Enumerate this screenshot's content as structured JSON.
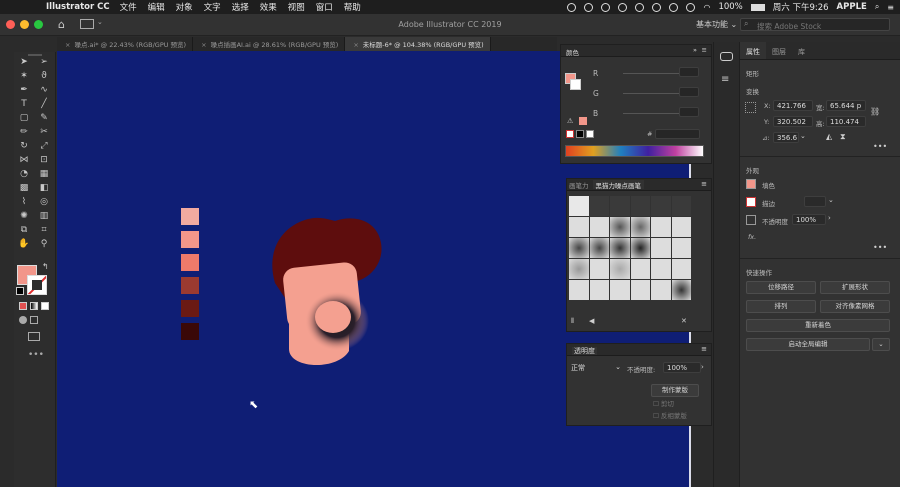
{
  "menubar": {
    "app_name": "Illustrator CC",
    "items": [
      "文件",
      "编辑",
      "对象",
      "文字",
      "选择",
      "效果",
      "视图",
      "窗口",
      "帮助"
    ],
    "battery": "100%",
    "clock": "周六 下午9:26",
    "user": "APPLE"
  },
  "appbar": {
    "title": "Adobe Illustrator CC 2019",
    "workspace": "基本功能",
    "search_placeholder": "搜索 Adobe Stock"
  },
  "tabs": [
    {
      "label": "噪点.ai* @ 22.43% (RGB/GPU 预览)"
    },
    {
      "label": "噪点插画AI.ai @ 28.61% (RGB/GPU 预览)"
    },
    {
      "label": "未标题-6* @ 104.38% (RGB/GPU 预览)"
    }
  ],
  "color_panel": {
    "title": "颜色",
    "channels": [
      "R",
      "G",
      "B"
    ],
    "hex_symbol": "#"
  },
  "brush_panel": {
    "tabs": [
      "画笔力",
      "黑猫力噪点画笔"
    ]
  },
  "transparency_panel": {
    "title": "透明度",
    "mode": "正常",
    "opacity_label": "不透明度:",
    "opacity_value": "100%",
    "make_mask": "制作蒙版",
    "clip": "剪切",
    "invert": "反相蒙版"
  },
  "properties_panel": {
    "tabs": [
      "属性",
      "图层",
      "库"
    ],
    "shape_label": "矩形",
    "transform_label": "变换",
    "x_label": "X:",
    "x_value": "421.766",
    "y_label": "Y:",
    "y_value": "320.502",
    "w_label": "宽:",
    "w_value": "65.644 p",
    "h_label": "高:",
    "h_value": "110.474",
    "angle_label": "⊿:",
    "angle_value": "356.6",
    "appearance_label": "外观",
    "fill_label": "填色",
    "stroke_label": "描边",
    "opacity_label": "不透明度",
    "opacity_value": "100%",
    "fx_label": "fx.",
    "quick_actions_label": "快速操作",
    "buttons": [
      "位移路径",
      "扩展形状",
      "排列",
      "对齐像素网格",
      "重新着色",
      "启动全局编辑"
    ]
  },
  "swatches": [
    "#f2aaa0",
    "#f2968a",
    "#ee7a6a",
    "#9b3a30",
    "#6b1a14",
    "#3a0808"
  ],
  "colors": {
    "canvas": "#0f1e75",
    "hair": "#5e0d0d",
    "face": "#f4a090",
    "beard": "#1a1a1a"
  }
}
